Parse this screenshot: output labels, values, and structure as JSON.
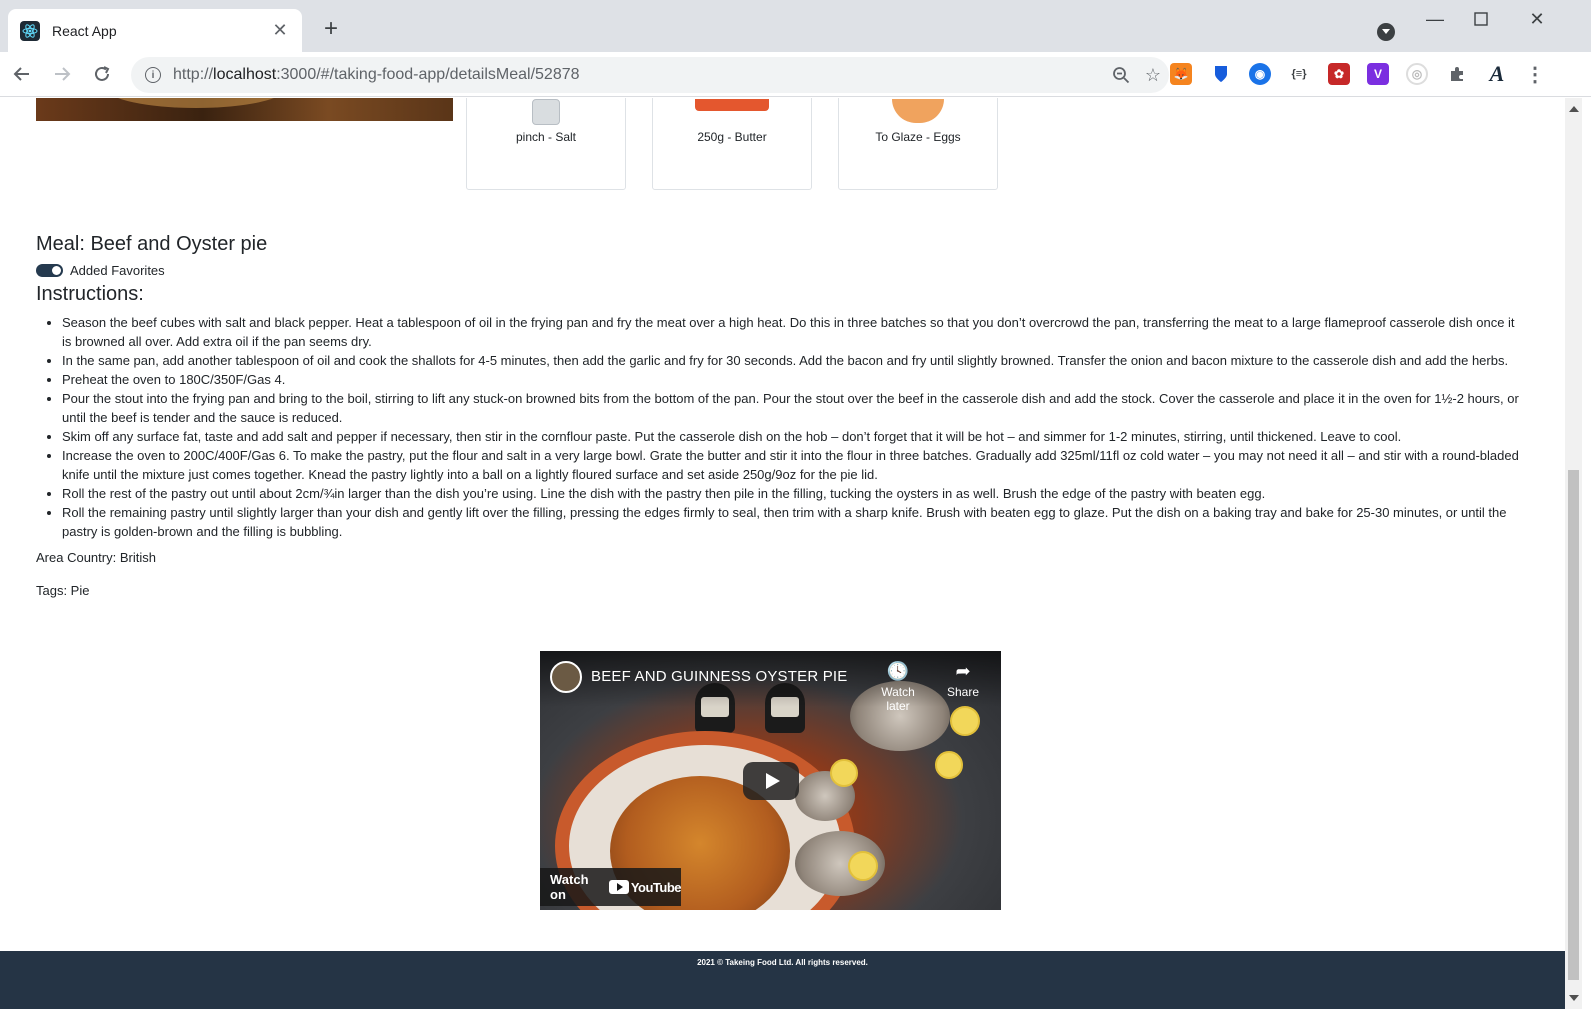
{
  "browser": {
    "tab_title": "React App",
    "url_prefix": "http://",
    "url_host": "localhost",
    "url_rest": ":3000/#/taking-food-app/detailsMeal/52878"
  },
  "ingredients": [
    {
      "label": "pinch - Salt"
    },
    {
      "label": "250g - Butter"
    },
    {
      "label": "To Glaze - Eggs"
    }
  ],
  "meal": {
    "title": "Meal: Beef and Oyster pie",
    "favorites_label": "Added Favorites",
    "favorite_on": true,
    "instructions_heading": "Instructions:",
    "instructions": [
      "Season the beef cubes with salt and black pepper. Heat a tablespoon of oil in the frying pan and fry the meat over a high heat. Do this in three batches so that you don’t overcrowd the pan, transferring the meat to a large flameproof casserole dish once it is browned all over. Add extra oil if the pan seems dry.",
      "In the same pan, add another tablespoon of oil and cook the shallots for 4-5 minutes, then add the garlic and fry for 30 seconds. Add the bacon and fry until slightly browned. Transfer the onion and bacon mixture to the casserole dish and add the herbs.",
      "Preheat the oven to 180C/350F/Gas 4.",
      "Pour the stout into the frying pan and bring to the boil, stirring to lift any stuck-on browned bits from the bottom of the pan. Pour the stout over the beef in the casserole dish and add the stock. Cover the casserole and place it in the oven for 1½-2 hours, or until the beef is tender and the sauce is reduced.",
      "Skim off any surface fat, taste and add salt and pepper if necessary, then stir in the cornflour paste. Put the casserole dish on the hob – don’t forget that it will be hot – and simmer for 1-2 minutes, stirring, until thickened. Leave to cool.",
      "Increase the oven to 200C/400F/Gas 6. To make the pastry, put the flour and salt in a very large bowl. Grate the butter and stir it into the flour in three batches. Gradually add 325ml/11fl oz cold water – you may not need it all – and stir with a round-bladed knife until the mixture just comes together. Knead the pastry lightly into a ball on a lightly floured surface and set aside 250g/9oz for the pie lid.",
      "Roll the rest of the pastry out until about 2cm/¾in larger than the dish you’re using. Line the dish with the pastry then pile in the filling, tucking the oysters in as well. Brush the edge of the pastry with beaten egg.",
      "Roll the remaining pastry until slightly larger than your dish and gently lift over the filling, pressing the edges firmly to seal, then trim with a sharp knife. Brush with beaten egg to glaze. Put the dish on a baking tray and bake for 25-30 minutes, or until the pastry is golden-brown and the filling is bubbling."
    ],
    "area": "Area Country: British",
    "tags": "Tags: Pie"
  },
  "video": {
    "title": "BEEF AND GUINNESS OYSTER PIE",
    "watch_later": "Watch later",
    "share": "Share",
    "watch_on": "Watch on",
    "youtube": "YouTube"
  },
  "footer": {
    "copyright": "2021 © Takeing Food Ltd. All rights reserved."
  },
  "colors": {
    "footer_bg": "#253445",
    "toggle_on": "#253a4f"
  }
}
